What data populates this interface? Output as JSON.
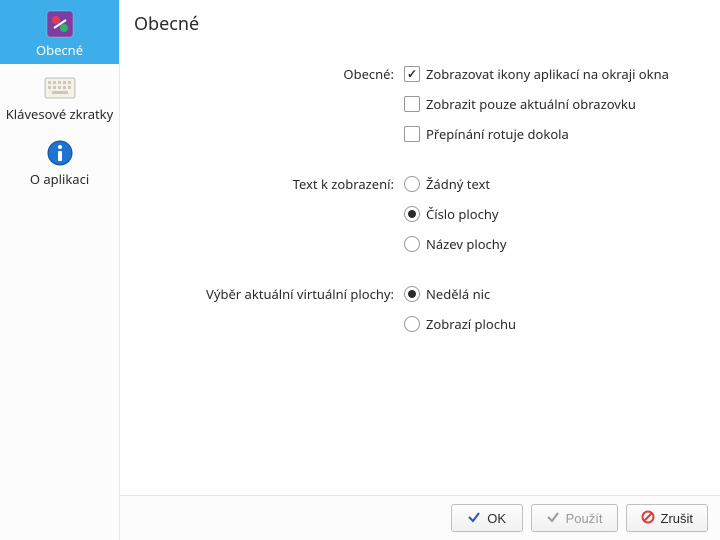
{
  "sidebar": {
    "items": [
      {
        "label": "Obecné"
      },
      {
        "label": "Klávesové zkratky"
      },
      {
        "label": "O aplikaci"
      }
    ]
  },
  "page": {
    "title": "Obecné"
  },
  "form": {
    "general": {
      "label": "Obecné:",
      "opt_show_icons": "Zobrazovat ikony aplikací na okraji okna",
      "opt_current_screen": "Zobrazit pouze aktuální obrazovku",
      "opt_wrap": "Přepínání rotuje dokola"
    },
    "text": {
      "label": "Text k zobrazení:",
      "opt_none": "Žádný text",
      "opt_number": "Číslo plochy",
      "opt_name": "Název plochy"
    },
    "current": {
      "label": "Výběr aktuální virtuální plochy:",
      "opt_nothing": "Nedělá nic",
      "opt_show": "Zobrazí plochu"
    }
  },
  "buttons": {
    "ok": "OK",
    "apply": "Použít",
    "cancel": "Zrušit"
  }
}
